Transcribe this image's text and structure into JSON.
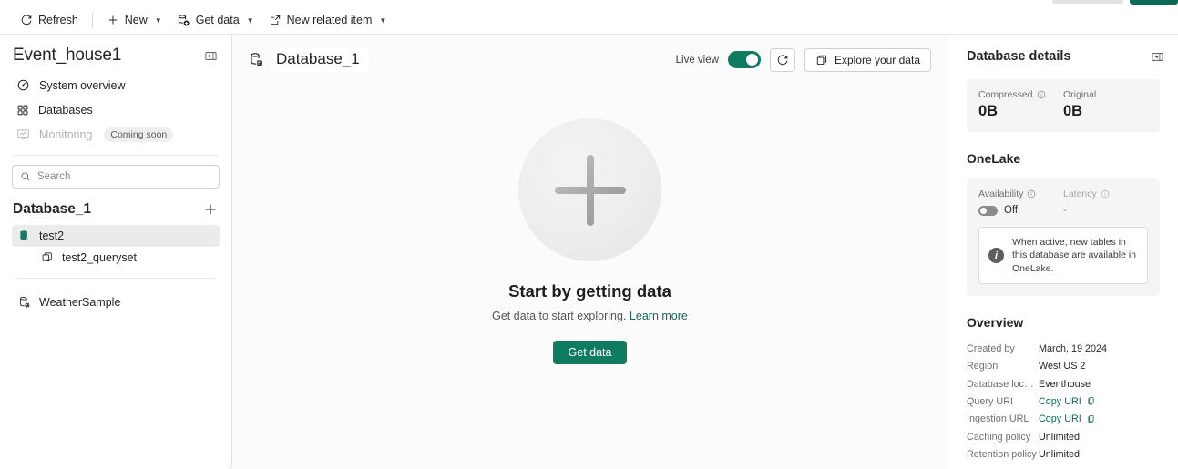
{
  "commandbar": {
    "items": [
      {
        "label": "Refresh",
        "icon": "refresh-icon",
        "caret": false
      },
      {
        "label": "New",
        "icon": "plus-icon",
        "caret": true
      },
      {
        "label": "Get data",
        "icon": "get-data-icon",
        "caret": true
      },
      {
        "label": "New related item",
        "icon": "external-link-icon",
        "caret": true
      }
    ]
  },
  "sidebar": {
    "title": "Event_house1",
    "collapse_icon": "collapse-panel-icon",
    "nav": [
      {
        "label": "System overview",
        "icon": "gauge-icon",
        "disabled": false,
        "badge": ""
      },
      {
        "label": "Databases",
        "icon": "grid-icon",
        "disabled": false,
        "badge": ""
      },
      {
        "label": "Monitoring",
        "icon": "monitor-icon",
        "disabled": true,
        "badge": "Coming soon"
      }
    ],
    "search": {
      "placeholder": "Search",
      "value": "",
      "icon": "search-icon"
    },
    "db_section": {
      "title": "Database_1",
      "add_icon": "plus-icon"
    },
    "tree": [
      {
        "label": "test2",
        "icon": "database-green-icon",
        "indent": false,
        "selected": true
      },
      {
        "label": "test2_queryset",
        "icon": "queryset-icon",
        "indent": true,
        "selected": false
      }
    ],
    "tree_group2": [
      {
        "label": "WeatherSample",
        "icon": "database-icon",
        "indent": false,
        "selected": false
      }
    ]
  },
  "main": {
    "title": "Database_1",
    "title_icon": "database-icon",
    "live_view_label": "Live view",
    "live_view_on": true,
    "refresh_icon": "refresh-icon",
    "explore_button": {
      "label": "Explore your data",
      "icon": "explore-icon"
    },
    "empty_state": {
      "plus_icon": "plus-circle-illustration",
      "title": "Start by getting data",
      "subtitle": "Get data to start exploring.",
      "link": "Learn more",
      "button": "Get data"
    }
  },
  "details": {
    "title": "Database details",
    "collapse_icon": "collapse-panel-icon",
    "stats": [
      {
        "label": "Compressed",
        "info": true,
        "value": "0B"
      },
      {
        "label": "Original",
        "info": false,
        "value": "0B"
      }
    ],
    "onelake": {
      "title": "OneLake",
      "availability_label": "Availability",
      "availability_value": "Off",
      "availability_on": false,
      "latency_label": "Latency",
      "latency_value": "-",
      "info_icon": "info-icon",
      "info_text": "When active, new tables in this database are available in OneLake."
    },
    "overview": {
      "title": "Overview",
      "rows": [
        {
          "key": "Created by",
          "value": "March, 19 2024",
          "link": false,
          "copy": false
        },
        {
          "key": "Region",
          "value": "West US 2",
          "link": false,
          "copy": false
        },
        {
          "key": "Database locati...",
          "value": "Eventhouse",
          "link": false,
          "copy": false
        },
        {
          "key": "Query URI",
          "value": "Copy URI",
          "link": true,
          "copy": true
        },
        {
          "key": "Ingestion URL",
          "value": "Copy URI",
          "link": true,
          "copy": true
        },
        {
          "key": "Caching policy",
          "value": "Unlimited",
          "link": false,
          "copy": false
        },
        {
          "key": "Retention policy",
          "value": "Unlimited",
          "link": false,
          "copy": false
        }
      ]
    }
  },
  "colors": {
    "accent_teal": "#0f7b5f",
    "link_teal": "#0f6c55",
    "selected_gray": "#ebebeb"
  }
}
